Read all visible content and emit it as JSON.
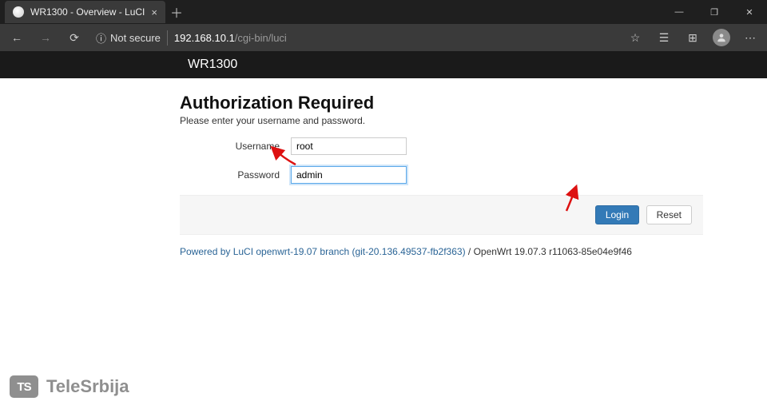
{
  "browser": {
    "tab": {
      "title": "WR1300 - Overview - LuCI"
    },
    "address": {
      "not_secure_label": "Not secure",
      "ip": "192.168.10.1",
      "path": "/cgi-bin/luci"
    }
  },
  "header": {
    "brand": "WR1300"
  },
  "auth": {
    "title": "Authorization Required",
    "subtitle": "Please enter your username and password.",
    "username_label": "Username",
    "username_value": "root",
    "password_label": "Password",
    "password_value": "admin",
    "login_button": "Login",
    "reset_button": "Reset"
  },
  "footer": {
    "link_text": "Powered by LuCI openwrt-19.07 branch (git-20.136.49537-fb2f363)",
    "version_text": " / OpenWrt 19.07.3 r11063-85e04e9f46"
  },
  "watermark": {
    "badge": "TS",
    "text": "TeleSrbija"
  }
}
